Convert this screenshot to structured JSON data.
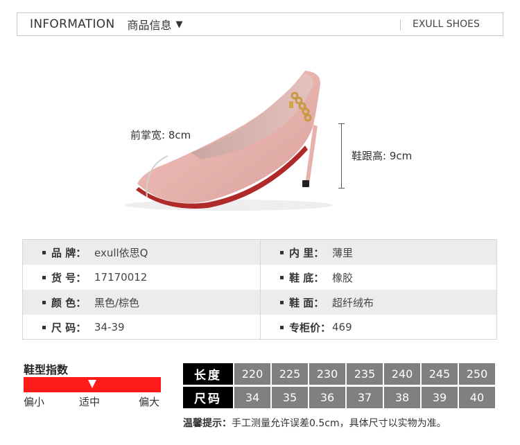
{
  "header": {
    "title_en": "INFORMATION",
    "title_zh": "商品信息",
    "dropdown_glyph": "▼",
    "brand": "EXULL SHOES"
  },
  "measurements": {
    "forefoot_width": "前掌宽: 8cm",
    "heel_height": "鞋跟高: 9cm"
  },
  "specs": {
    "rows": [
      {
        "left": {
          "label": "品  牌：",
          "value": "exull依思Q"
        },
        "right": {
          "label": "内  里：",
          "value": "薄里"
        }
      },
      {
        "left": {
          "label": "货  号：",
          "value": "17170012"
        },
        "right": {
          "label": "鞋  底：",
          "value": "橡胶"
        }
      },
      {
        "left": {
          "label": "颜  色：",
          "value": "黑色/棕色"
        },
        "right": {
          "label": "鞋  面：",
          "value": "超纤绒布"
        }
      },
      {
        "left": {
          "label": "尺  码：",
          "value": "34-39"
        },
        "right": {
          "label": "专柜价：",
          "value": "469"
        }
      }
    ]
  },
  "fit": {
    "title": "鞋型指数",
    "small": "偏小",
    "normal": "适中",
    "large": "偏大",
    "level": 0.5
  },
  "size_table": {
    "length_label": "长度",
    "size_label": "尺码",
    "lengths": [
      "220",
      "225",
      "230",
      "235",
      "240",
      "245",
      "250"
    ],
    "sizes": [
      "34",
      "35",
      "36",
      "37",
      "38",
      "39",
      "40"
    ]
  },
  "note": {
    "prefix": "温馨提示：",
    "text": "手工测量允许误差0.5cm，具体尺寸以实物为准。"
  },
  "colors": {
    "shoe_suede": "#e8b4b0",
    "fit_bar": "#ff1a1a",
    "size_head": "#000000",
    "size_cell": "#808080",
    "row_shade": "#ececec"
  }
}
